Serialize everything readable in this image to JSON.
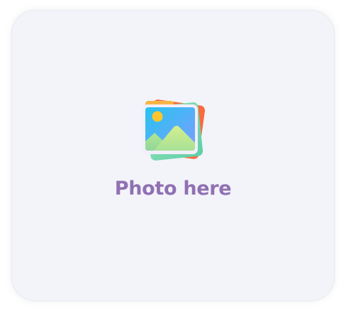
{
  "placeholder": {
    "label": "Photo here",
    "icon": "photo-stack-icon"
  },
  "colors": {
    "card_background": "#f2f4f9",
    "label": "#9070b3",
    "sky_top": "#28c0f0",
    "sky_bottom": "#7ba6ff",
    "sun": "#fbc62d",
    "mountain_light": "#cde98a",
    "mountain_dark": "#9bdc8a",
    "back_photo_orange": "#fa6a3e",
    "back_photo_green": "#6fd8b0"
  }
}
